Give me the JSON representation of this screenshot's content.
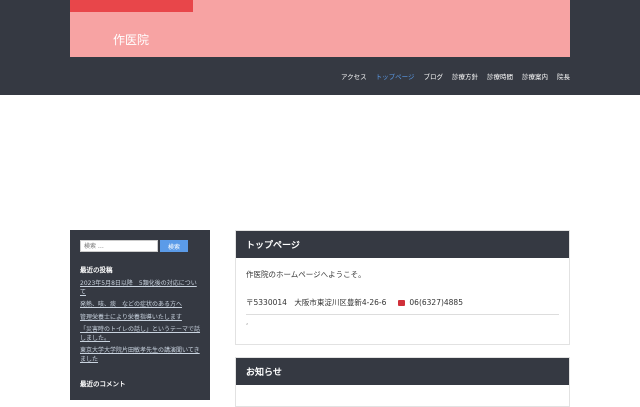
{
  "header": {
    "site_title": "作医院",
    "nav": [
      "アクセス",
      "トップページ",
      "ブログ",
      "診療方針",
      "診療時間",
      "診療案内",
      "院長"
    ],
    "active_nav": "トップページ"
  },
  "sidebar": {
    "search_placeholder": "検索 …",
    "search_button": "検索",
    "recent_posts_title": "最近の投稿",
    "recent_posts": [
      "2023年5月8日以降　5類化後の対応について",
      "発熱、咳、痰　などの症状のある方へ",
      "管理栄養士により栄養指導いたします",
      "「災害時のトイレの話し」というテーマで話しました。",
      "東京大学大学院片田敏孝先生の講演聞いてきました"
    ],
    "recent_comments_title": "最近のコメント"
  },
  "main": {
    "card1": {
      "title": "トップページ",
      "welcome": "作医院のホームページへようこそ。",
      "postal": "〒5330014　大阪市東淀川区豊新4-26-6",
      "phone": "06(6327)4885",
      "extra": ","
    },
    "card2": {
      "title": "お知らせ"
    }
  },
  "colors": {
    "header_bg": "#353942",
    "hero_bg": "#f7a3a3",
    "accent": "#5b9be8",
    "stripe": "#e8464a"
  }
}
